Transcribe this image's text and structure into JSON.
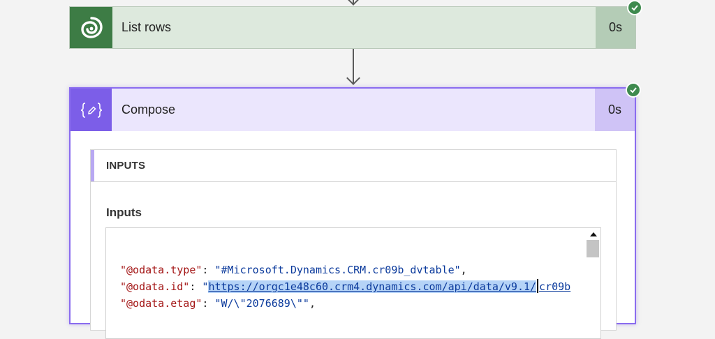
{
  "steps": [
    {
      "title": "List rows",
      "duration": "0s",
      "status": "succeeded",
      "icon": "dataverse-icon",
      "color": "#3d7c45"
    },
    {
      "title": "Compose",
      "duration": "0s",
      "status": "succeeded",
      "icon": "compose-icon",
      "color": "#7c5ee8",
      "inputs_section_label": "INPUTS",
      "inputs_field_label": "Inputs",
      "code": {
        "line1": {
          "key": "\"@odata.type\"",
          "sep": ": ",
          "value": "\"#Microsoft.Dynamics.CRM.cr09b_dvtable\"",
          "tail": ","
        },
        "line2": {
          "key": "\"@odata.id\"",
          "sep": ": ",
          "quote": "\"",
          "link_selected": "https://orgc1e48c60.crm4.dynamics.com/api/data/v9.1/",
          "link_rest": "cr09b"
        },
        "line3": {
          "key": "\"@odata.etag\"",
          "sep": ": ",
          "value": "\"W/\\\"2076689\\\"\"",
          "tail": ","
        }
      }
    }
  ]
}
